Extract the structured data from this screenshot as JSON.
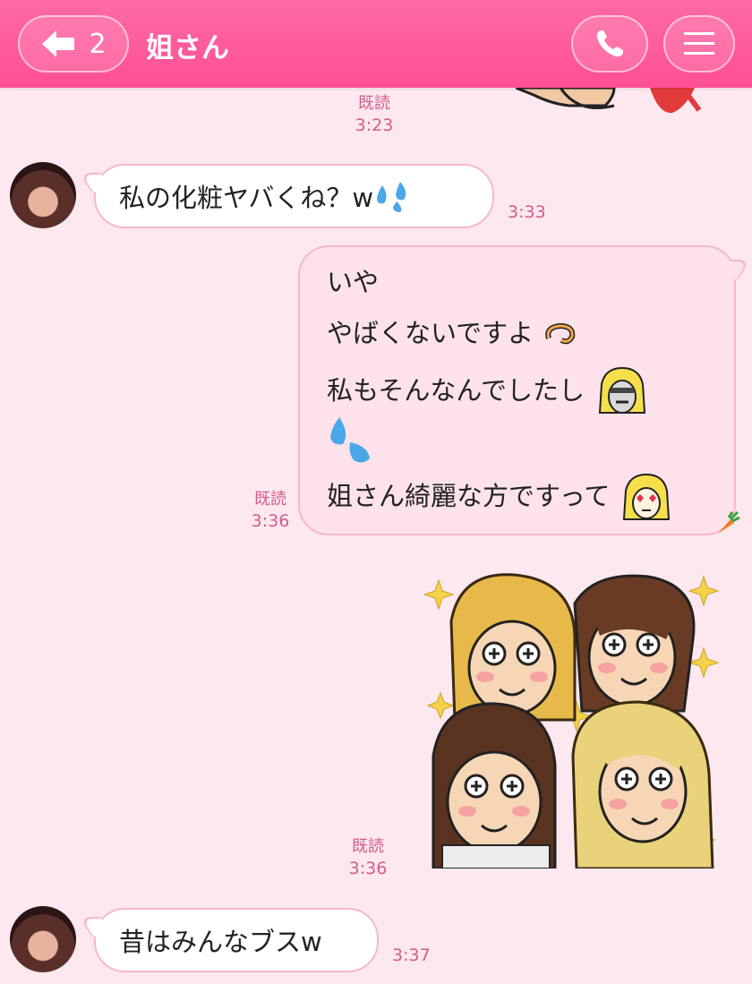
{
  "header": {
    "back_count": "2",
    "title": "姐さん"
  },
  "messages": [
    {
      "meta_read": "既読",
      "meta_time": "3:23"
    },
    {
      "text": "私の化粧ヤバくね？w",
      "time": "3:33"
    },
    {
      "lines": [
        "いや",
        "やばくないですよ",
        "私もそんなんでしたし",
        "",
        "姐さん綺麗な方ですって"
      ],
      "read": "既読",
      "time": "3:36"
    },
    {
      "read": "既読",
      "time": "3:36"
    },
    {
      "text": "昔はみんなブスw",
      "time": "3:37"
    }
  ],
  "colors": {
    "header": "#ff5a9a",
    "background": "#fde8ef",
    "incoming_bubble": "#ffffff",
    "outgoing_bubble": "#fde2ec",
    "meta_text": "#d45c89"
  },
  "icons": [
    "back-arrow-icon",
    "phone-icon",
    "menu-icon",
    "sweat-drops-icon",
    "curl-emoji-icon",
    "scared-girl-emoji-icon",
    "heart-eyes-girl-emoji-icon",
    "carrot-icon"
  ]
}
